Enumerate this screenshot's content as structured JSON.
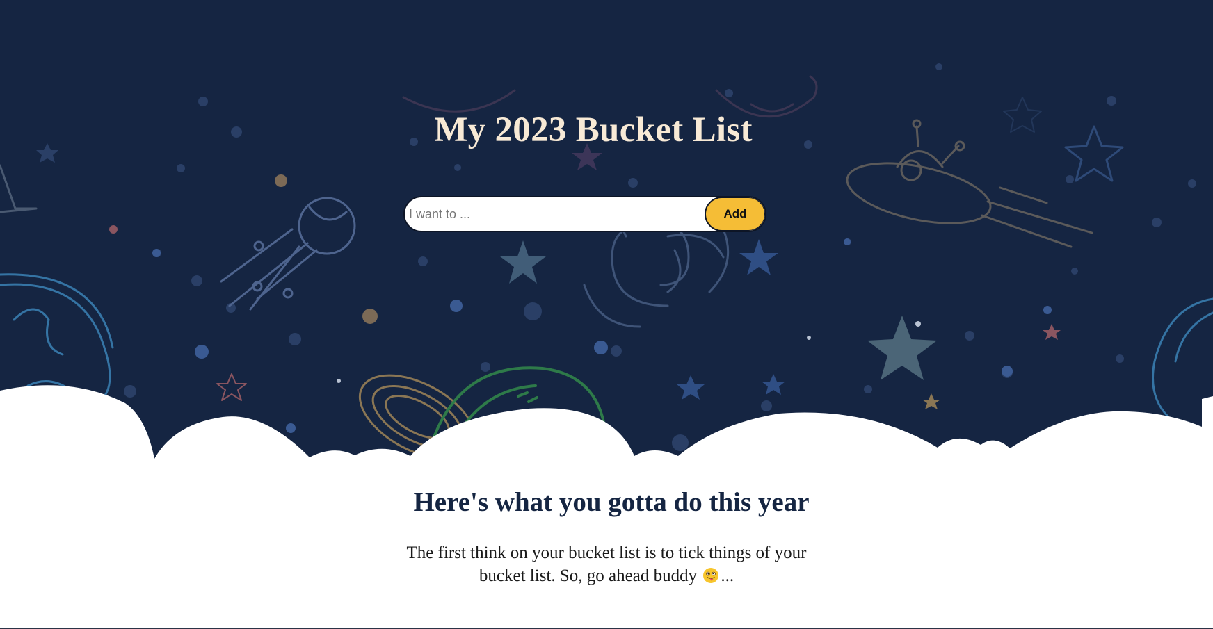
{
  "hero": {
    "title": "My 2023 Bucket List",
    "input_placeholder": "I want to ...",
    "input_value": "",
    "add_label": "Add"
  },
  "content": {
    "heading": "Here's what you gotta do this year",
    "text_before_emoji": "The first think on your bucket list is to tick things of your bucket list. So, go ahead buddy",
    "text_after_emoji": "...",
    "emoji_icon": "winking-face-with-tongue-icon"
  },
  "colors": {
    "hero_background": "#152542",
    "title_color": "#f8ead6",
    "accent": "#f5bd36",
    "heading_color": "#152542"
  }
}
